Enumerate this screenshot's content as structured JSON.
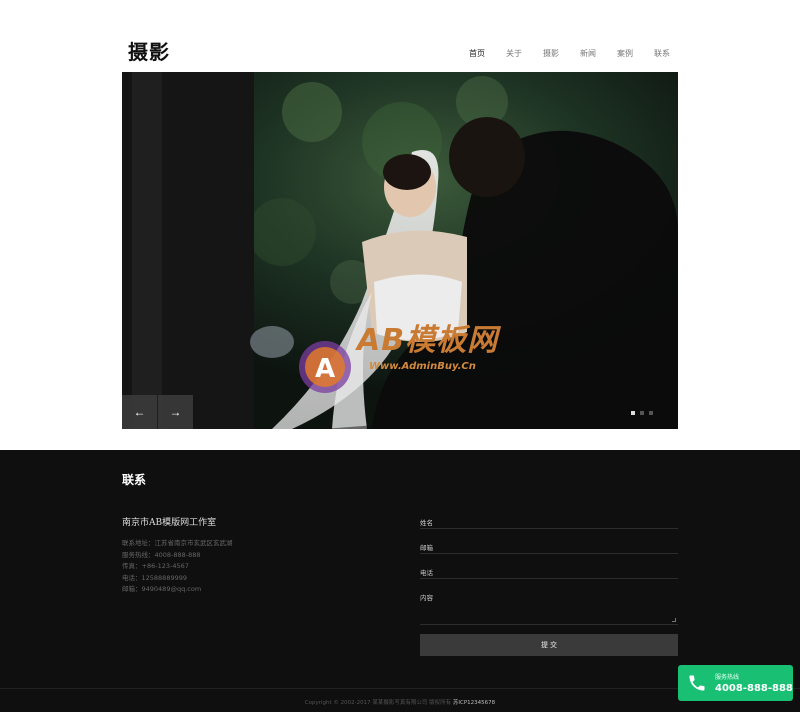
{
  "header": {
    "logo": "摄影",
    "nav": [
      "首页",
      "关于",
      "摄影",
      "新闻",
      "案例",
      "联系"
    ]
  },
  "hero": {
    "watermark_text": "AB模板网",
    "watermark_url": "Www.AdminBuy.Cn",
    "prev_icon": "←",
    "next_icon": "→",
    "slides": 3,
    "active_slide": 1
  },
  "contact": {
    "title": "联系",
    "studio": "南京市AB模版网工作室",
    "address": "联系地址：江苏省南京市玄武区玄武湖",
    "hotline": "服务热线：4008-888-888",
    "mobile": "传真：+86-123-4567",
    "phone": "电话：12588889999",
    "email": "邮箱：9490489@qq.com"
  },
  "form": {
    "name_label": "姓名",
    "email_label": "邮箱",
    "phone_label": "电话",
    "content_label": "内容",
    "submit_label": "提 交"
  },
  "footer": {
    "copyright": "Copyright © 2002-2017 某某摄影写真有限公司 版权所有",
    "icp": "苏ICP12345678"
  },
  "hotline_widget": {
    "label": "服务热线",
    "number": "4008-888-888",
    "icon": "phone-icon",
    "color": "#19c074"
  }
}
